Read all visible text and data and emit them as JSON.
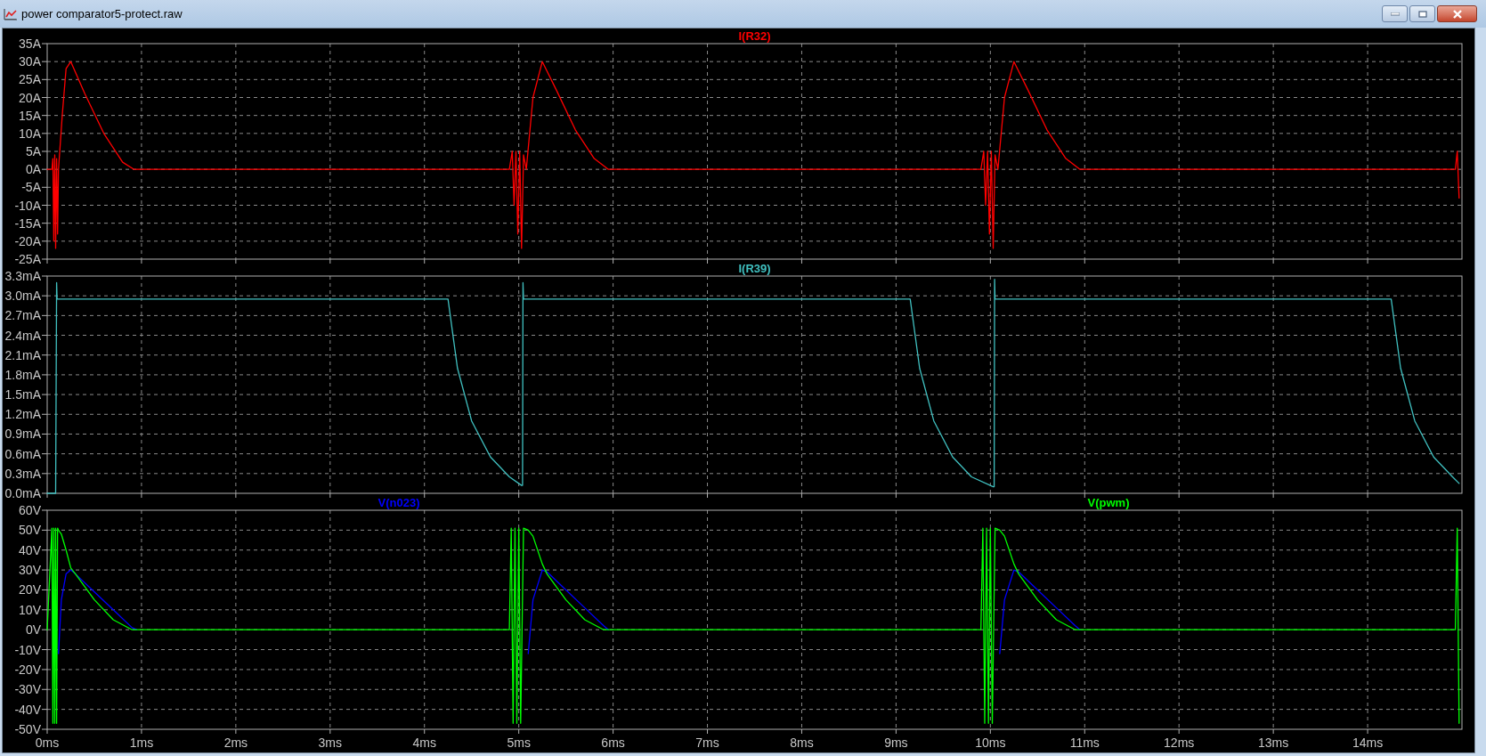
{
  "window": {
    "title": "power comparator5-protect.raw"
  },
  "panes": [
    {
      "chart_data": {
        "type": "line",
        "grid": true,
        "xlim": [
          0,
          15
        ],
        "ylim": [
          -25,
          35
        ],
        "yticks": [
          {
            "value": 35,
            "label": "35A"
          },
          {
            "value": 30,
            "label": "30A"
          },
          {
            "value": 25,
            "label": "25A"
          },
          {
            "value": 20,
            "label": "20A"
          },
          {
            "value": 15,
            "label": "15A"
          },
          {
            "value": 10,
            "label": "10A"
          },
          {
            "value": 5,
            "label": "5A"
          },
          {
            "value": 0,
            "label": "0A"
          },
          {
            "value": -5,
            "label": "-5A"
          },
          {
            "value": -10,
            "label": "-10A"
          },
          {
            "value": -15,
            "label": "-15A"
          },
          {
            "value": -20,
            "label": "-20A"
          },
          {
            "value": -25,
            "label": "-25A"
          }
        ],
        "x": [
          0,
          0.05,
          0.06,
          0.07,
          0.08,
          0.09,
          0.1,
          0.11,
          0.12,
          0.16,
          0.2,
          0.25,
          0.4,
          0.6,
          0.8,
          0.92,
          4.9,
          4.93,
          4.95,
          4.97,
          4.99,
          5.01,
          5.03,
          5.05,
          5.08,
          5.15,
          5.25,
          5.4,
          5.6,
          5.8,
          5.95,
          9.9,
          9.93,
          9.95,
          9.97,
          9.99,
          10.01,
          10.03,
          10.05,
          10.08,
          10.15,
          10.25,
          10.4,
          10.6,
          10.8,
          10.95,
          14.93,
          14.95,
          14.97
        ],
        "series": [
          {
            "name": "I(R32)",
            "color": "#ff0000",
            "values": [
              0,
              0,
              3,
              -20,
              4,
              -22,
              3,
              -18,
              0,
              15,
              28,
              30,
              21,
              10,
              2,
              0,
              0,
              5,
              -10,
              5,
              -18,
              5,
              -22,
              4,
              0,
              20,
              30,
              22,
              11,
              3,
              0,
              0,
              5,
              -10,
              5,
              -18,
              5,
              -22,
              4,
              0,
              20,
              30,
              22,
              11,
              3,
              0,
              0,
              5,
              -8
            ]
          }
        ]
      }
    },
    {
      "chart_data": {
        "type": "line",
        "grid": true,
        "xlim": [
          0,
          15
        ],
        "ylim": [
          0,
          3.3
        ],
        "yticks": [
          {
            "value": 3.3,
            "label": "3.3mA"
          },
          {
            "value": 3.0,
            "label": "3.0mA"
          },
          {
            "value": 2.7,
            "label": "2.7mA"
          },
          {
            "value": 2.4,
            "label": "2.4mA"
          },
          {
            "value": 2.1,
            "label": "2.1mA"
          },
          {
            "value": 1.8,
            "label": "1.8mA"
          },
          {
            "value": 1.5,
            "label": "1.5mA"
          },
          {
            "value": 1.2,
            "label": "1.2mA"
          },
          {
            "value": 0.9,
            "label": "0.9mA"
          },
          {
            "value": 0.6,
            "label": "0.6mA"
          },
          {
            "value": 0.3,
            "label": "0.3mA"
          },
          {
            "value": 0,
            "label": "0.0mA"
          }
        ],
        "x": [
          0,
          0.09,
          0.1,
          0.105,
          0.11,
          4.25,
          4.35,
          4.5,
          4.7,
          4.9,
          5.03,
          5.04,
          5.045,
          5.05,
          9.15,
          9.25,
          9.4,
          9.6,
          9.8,
          10.03,
          10.04,
          10.045,
          10.05,
          14.25,
          14.35,
          14.5,
          14.7,
          14.9,
          14.97
        ],
        "series": [
          {
            "name": "I(R39)",
            "color": "#40c0c0",
            "values": [
              0,
              0,
              3.2,
              2.95,
              2.95,
              2.95,
              1.9,
              1.1,
              0.55,
              0.25,
              0.12,
              0.12,
              3.2,
              2.95,
              2.95,
              1.9,
              1.1,
              0.55,
              0.25,
              0.1,
              0.1,
              3.25,
              2.95,
              2.95,
              1.9,
              1.1,
              0.55,
              0.25,
              0.15
            ]
          }
        ]
      }
    },
    {
      "chart_data": {
        "type": "line",
        "grid": true,
        "xlim": [
          0,
          15
        ],
        "ylim": [
          -50,
          60
        ],
        "xticks": [
          {
            "value": 0,
            "label": "0ms"
          },
          {
            "value": 1,
            "label": "1ms"
          },
          {
            "value": 2,
            "label": "2ms"
          },
          {
            "value": 3,
            "label": "3ms"
          },
          {
            "value": 4,
            "label": "4ms"
          },
          {
            "value": 5,
            "label": "5ms"
          },
          {
            "value": 6,
            "label": "6ms"
          },
          {
            "value": 7,
            "label": "7ms"
          },
          {
            "value": 8,
            "label": "8ms"
          },
          {
            "value": 9,
            "label": "9ms"
          },
          {
            "value": 10,
            "label": "10ms"
          },
          {
            "value": 11,
            "label": "11ms"
          },
          {
            "value": 12,
            "label": "12ms"
          },
          {
            "value": 13,
            "label": "13ms"
          },
          {
            "value": 14,
            "label": "14ms"
          }
        ],
        "yticks": [
          {
            "value": 60,
            "label": "60V"
          },
          {
            "value": 50,
            "label": "50V"
          },
          {
            "value": 40,
            "label": "40V"
          },
          {
            "value": 30,
            "label": "30V"
          },
          {
            "value": 20,
            "label": "20V"
          },
          {
            "value": 10,
            "label": "10V"
          },
          {
            "value": 0,
            "label": "0V"
          },
          {
            "value": -10,
            "label": "-10V"
          },
          {
            "value": -20,
            "label": "-20V"
          },
          {
            "value": -30,
            "label": "-30V"
          },
          {
            "value": -40,
            "label": "-40V"
          },
          {
            "value": -50,
            "label": "-50V"
          }
        ],
        "x": [
          0,
          0.05,
          0.06,
          0.07,
          0.08,
          0.09,
          0.1,
          0.11,
          0.12,
          0.15,
          0.2,
          0.25,
          0.3,
          0.5,
          0.7,
          0.9,
          0.95,
          4.9,
          4.92,
          4.94,
          4.96,
          4.98,
          5.0,
          5.02,
          5.05,
          5.1,
          5.15,
          5.25,
          5.3,
          5.5,
          5.7,
          5.9,
          5.95,
          9.9,
          9.92,
          9.94,
          9.96,
          9.98,
          10.0,
          10.02,
          10.05,
          10.1,
          10.15,
          10.25,
          10.3,
          10.5,
          10.7,
          10.9,
          10.95,
          14.93,
          14.95,
          14.97
        ],
        "series": [
          {
            "name": "V(n023)",
            "color": "#0000ff",
            "values": [
              null,
              null,
              null,
              null,
              null,
              null,
              null,
              null,
              -12,
              15,
              28,
              30,
              28,
              19,
              10,
              1,
              0,
              null,
              null,
              null,
              null,
              null,
              null,
              null,
              null,
              -12,
              15,
              30,
              29,
              20,
              11,
              2,
              0,
              null,
              null,
              null,
              null,
              null,
              null,
              null,
              null,
              -12,
              15,
              30,
              29,
              20,
              11,
              2,
              0,
              null,
              null,
              null
            ]
          },
          {
            "name": "V(pwm)",
            "color": "#00ff00",
            "values": [
              0,
              51,
              -47,
              51,
              -47,
              51,
              -47,
              51,
              50,
              48,
              40,
              31,
              28,
              15,
              5,
              0,
              0,
              0,
              51,
              -47,
              51,
              -47,
              51,
              -47,
              51,
              50,
              47,
              33,
              28,
              15,
              5,
              0,
              0,
              0,
              51,
              -47,
              51,
              -47,
              51,
              -47,
              51,
              50,
              47,
              33,
              28,
              15,
              5,
              0,
              0,
              0,
              51,
              -47
            ]
          }
        ]
      }
    }
  ]
}
